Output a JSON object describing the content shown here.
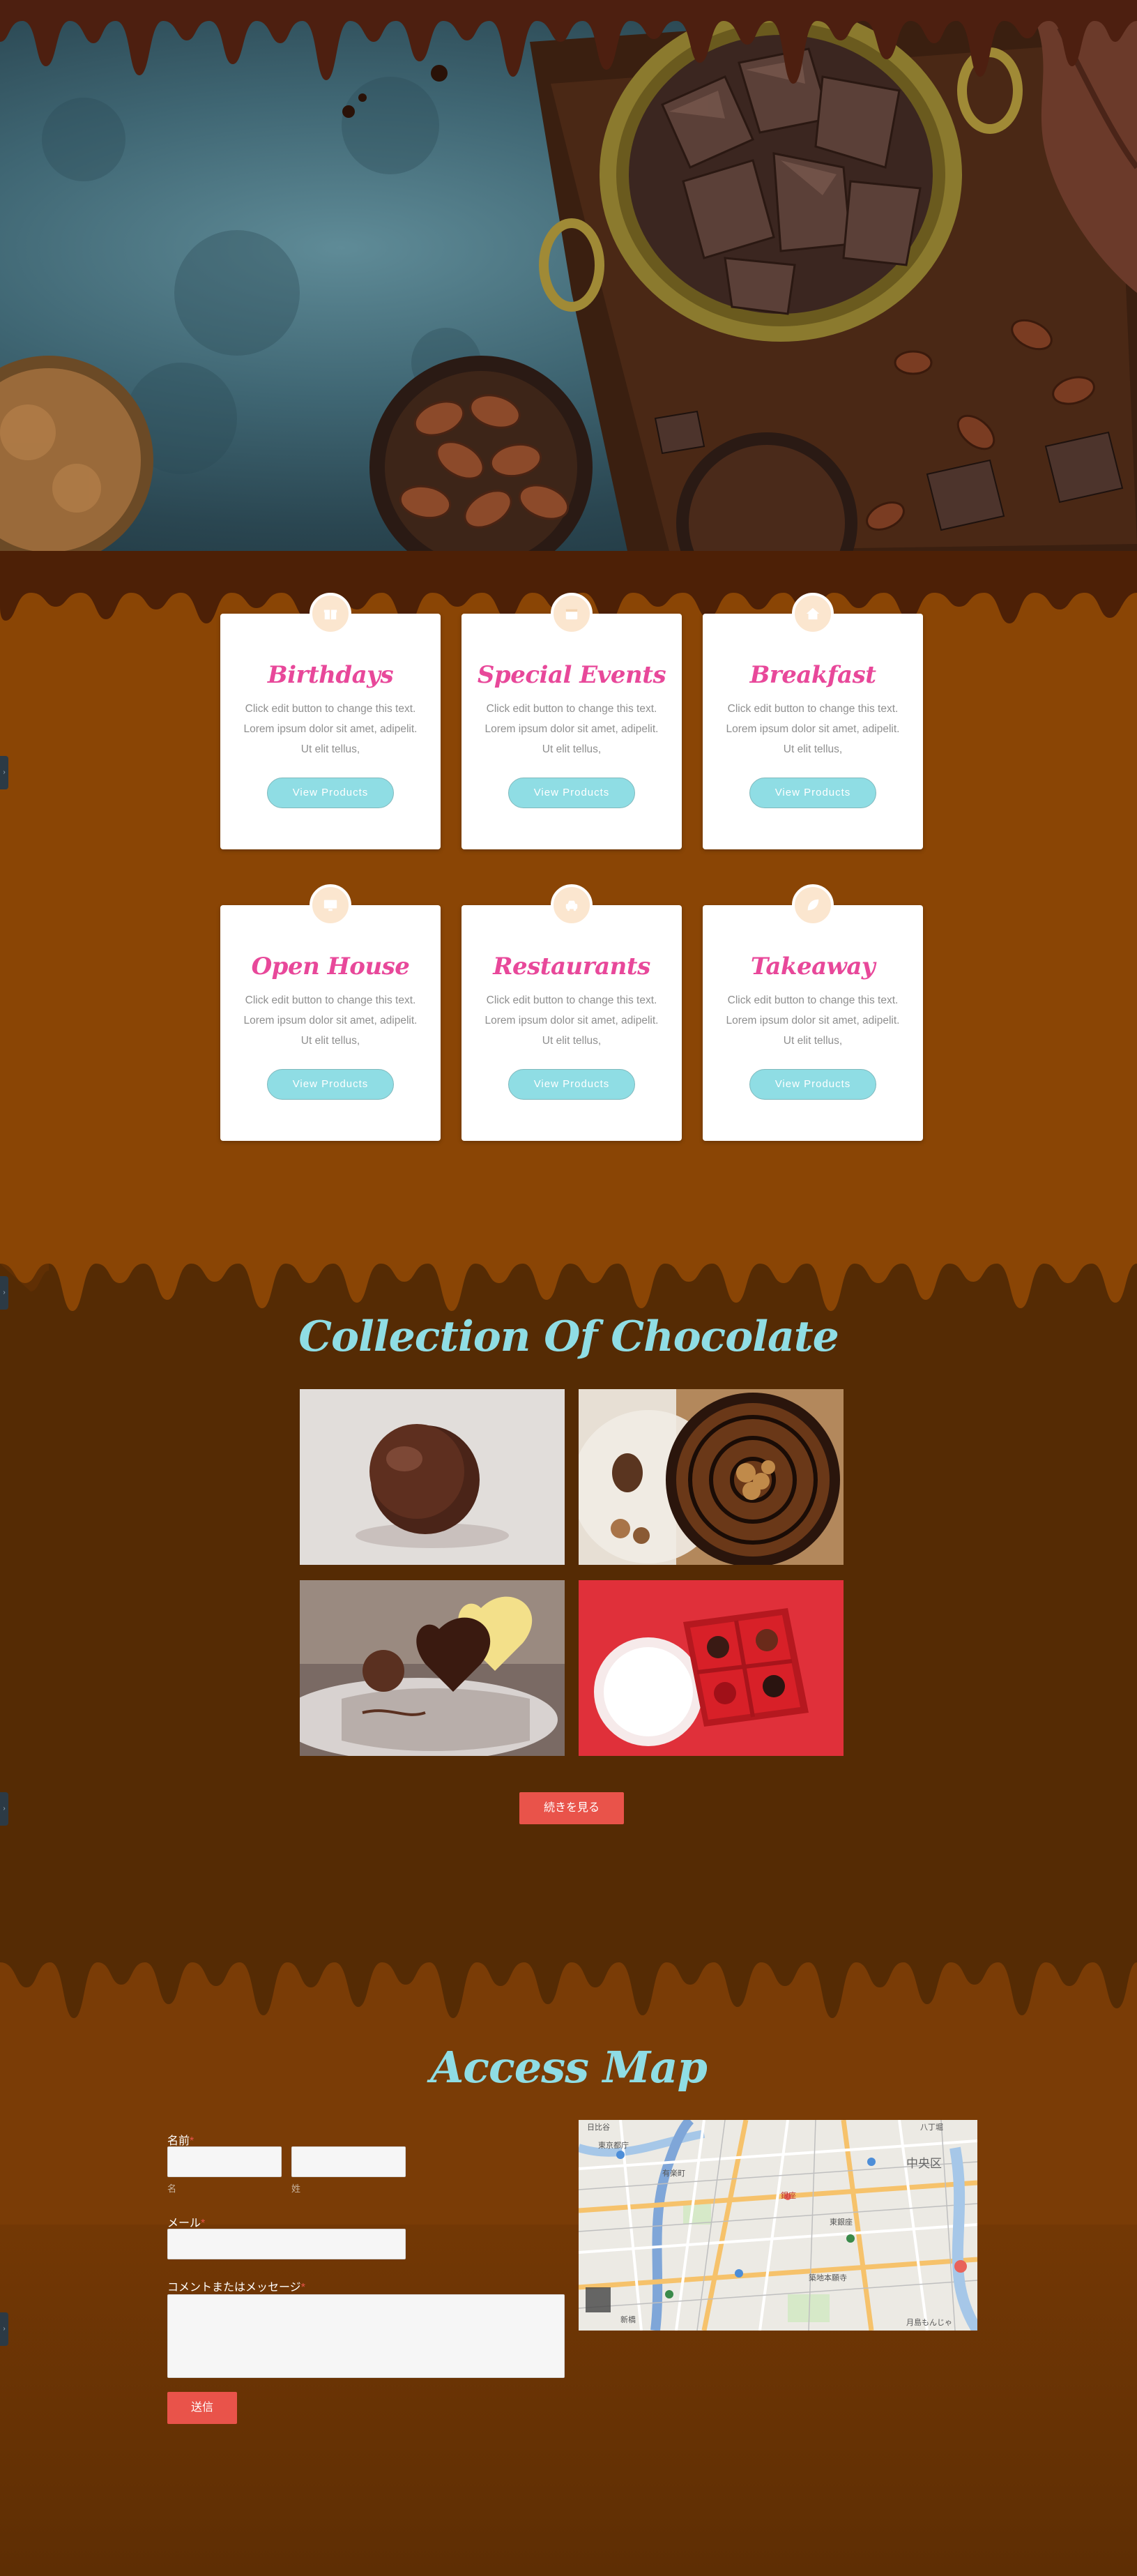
{
  "colors": {
    "accent_pink": "#e8489a",
    "accent_teal": "#8fdde4",
    "button_red": "#e9534a",
    "chocolate_light": "#8a4505",
    "chocolate_dark": "#552b04",
    "chocolate_drip": "#4d2006"
  },
  "hero": {
    "image": "chocolate-and-cocoa-beans-photo"
  },
  "services": {
    "cards": [
      {
        "title": "Birthdays",
        "icon": "gift-icon",
        "text": "Click edit button to change this text. Lorem ipsum dolor sit amet, adipelit. Ut elit tellus,",
        "button": "View Products"
      },
      {
        "title": "Special Events",
        "icon": "calendar-icon",
        "text": "Click edit button to change this text. Lorem ipsum dolor sit amet, adipelit. Ut elit tellus,",
        "button": "View Products"
      },
      {
        "title": "Breakfast",
        "icon": "home-icon",
        "text": "Click edit button to change this text. Lorem ipsum dolor sit amet, adipelit. Ut elit tellus,",
        "button": "View Products"
      },
      {
        "title": "Open House",
        "icon": "monitor-icon",
        "text": "Click edit button to change this text. Lorem ipsum dolor sit amet, adipelit. Ut elit tellus,",
        "button": "View Products"
      },
      {
        "title": "Restaurants",
        "icon": "car-icon",
        "text": "Click edit button to change this text. Lorem ipsum dolor sit amet, adipelit. Ut elit tellus,",
        "button": "View Products"
      },
      {
        "title": "Takeaway",
        "icon": "leaf-icon",
        "text": "Click edit button to change this text. Lorem ipsum dolor sit amet, adipelit. Ut elit tellus,",
        "button": "View Products"
      }
    ]
  },
  "collection": {
    "title": "Collection Of Chocolate",
    "photos": [
      "chocolate-truffle-photo",
      "chocolate-walnut-tart-photo",
      "heart-chocolates-cake-photo",
      "red-chocolate-box-photo"
    ],
    "more_button": "続きを見る"
  },
  "access": {
    "title": "Access Map",
    "form": {
      "name_label": "名前",
      "first_name_sub": "名",
      "last_name_sub": "姓",
      "email_label": "メール",
      "message_label": "コメントまたはメッセージ",
      "required_mark": "*",
      "submit": "送信"
    },
    "map": {
      "district_label": "中央区",
      "labels": [
        "日比谷",
        "銀座",
        "東京都庁",
        "築地本願寺",
        "新橋",
        "東銀座",
        "有楽町",
        "八丁堀",
        "月島もんじゃ"
      ]
    }
  }
}
